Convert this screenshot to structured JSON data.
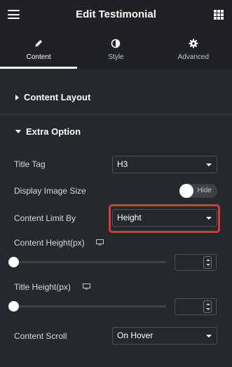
{
  "header": {
    "title": "Edit Testimonial",
    "menu_icon": "hamburger-menu-icon",
    "apps_icon": "grid-apps-icon"
  },
  "tabs": [
    {
      "label": "Content",
      "icon": "pencil-icon",
      "active": true
    },
    {
      "label": "Style",
      "icon": "half-circle-icon",
      "active": false
    },
    {
      "label": "Advanced",
      "icon": "gear-icon",
      "active": false
    }
  ],
  "sections": {
    "content_layout": {
      "title": "Content Layout",
      "expanded": false
    },
    "extra_option": {
      "title": "Extra Option",
      "expanded": true
    }
  },
  "controls": {
    "title_tag": {
      "label": "Title Tag",
      "value": "H3"
    },
    "display_image_size": {
      "label": "Display Image Size",
      "toggle_text": "Hide",
      "on": false
    },
    "content_limit_by": {
      "label": "Content Limit By",
      "value": "Height",
      "highlighted": true
    },
    "content_height": {
      "label": "Content Height(px)",
      "value": "",
      "responsive_icon": "desktop-monitor-icon"
    },
    "title_height": {
      "label": "Title Height(px)",
      "value": "",
      "responsive_icon": "desktop-monitor-icon"
    },
    "content_scroll": {
      "label": "Content Scroll",
      "value": "On Hover"
    }
  },
  "colors": {
    "background": "#26292c",
    "header": "#1f2124",
    "highlight": "#d63a3a"
  }
}
